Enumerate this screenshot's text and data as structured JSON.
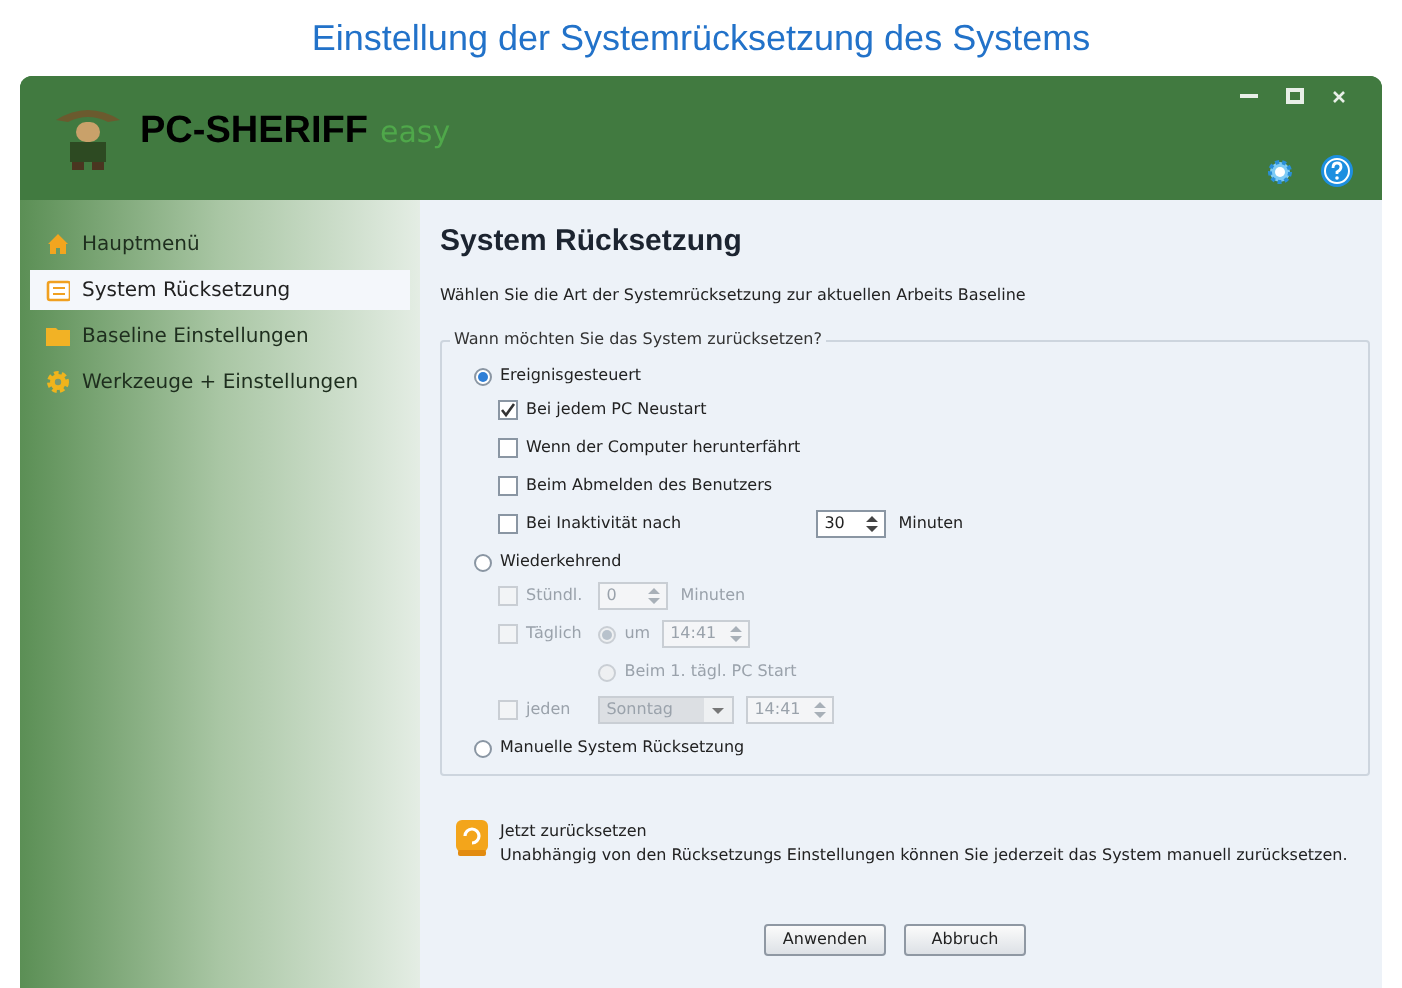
{
  "caption": "Einstellung der Systemrücksetzung des Systems",
  "app": {
    "logo": "PC-SHERIFF",
    "logo_suffix": "easy"
  },
  "sidebar": {
    "items": [
      {
        "label": "Hauptmenü",
        "selected": false
      },
      {
        "label": "System Rücksetzung",
        "selected": true
      },
      {
        "label": "Baseline Einstellungen",
        "selected": false
      },
      {
        "label": "Werkzeuge + Einstellungen",
        "selected": false
      }
    ]
  },
  "content": {
    "title": "System Rücksetzung",
    "subtitle": "Wählen Sie die Art der Systemrücksetzung zur aktuellen Arbeits Baseline",
    "group": {
      "legend": "Wann möchten Sie das System zurücksetzen?",
      "options": [
        {
          "kind": "radio",
          "label": "Ereignisgesteuert",
          "selected": true,
          "disabled": false,
          "children": [
            {
              "kind": "checkbox",
              "label": "Bei jedem PC Neustart",
              "checked": true,
              "disabled": false
            },
            {
              "kind": "checkbox",
              "label": "Wenn der Computer herunterfährt",
              "checked": false,
              "disabled": false
            },
            {
              "kind": "checkbox",
              "label": "Beim Abmelden des Benutzers",
              "checked": false,
              "disabled": false
            },
            {
              "kind": "checkbox",
              "label": "Bei Inaktivität nach",
              "checked": false,
              "disabled": false,
              "controls": [
                {
                  "kind": "spin",
                  "value": "30",
                  "disabled": false
                },
                {
                  "kind": "unit",
                  "label": "Minuten",
                  "disabled": false
                }
              ]
            }
          ]
        },
        {
          "kind": "radio",
          "label": "Wiederkehrend",
          "selected": false,
          "disabled": false,
          "children": [
            {
              "kind": "checkbox",
              "label": "Stündl.",
              "checked": false,
              "disabled": true,
              "controls": [
                {
                  "kind": "spin",
                  "value": "0",
                  "disabled": true
                },
                {
                  "kind": "unit",
                  "label": "Minuten",
                  "disabled": true
                }
              ]
            },
            {
              "kind": "checkbox",
              "label": "Täglich",
              "checked": false,
              "disabled": true,
              "controls": [
                {
                  "kind": "radio",
                  "label": "um",
                  "selected": true,
                  "disabled": true
                },
                {
                  "kind": "spin",
                  "value": "14:41",
                  "disabled": true
                }
              ],
              "children": [
                {
                  "kind": "radio",
                  "label": "Beim 1. tägl. PC Start",
                  "selected": false,
                  "disabled": true
                }
              ]
            },
            {
              "kind": "checkbox",
              "label": "jeden",
              "checked": false,
              "disabled": true,
              "controls": [
                {
                  "kind": "dropdown",
                  "value": "Sonntag",
                  "disabled": true
                },
                {
                  "kind": "spin",
                  "value": "14:41",
                  "disabled": true
                }
              ]
            }
          ]
        },
        {
          "kind": "radio",
          "label": "Manuelle System Rücksetzung",
          "selected": false,
          "disabled": false
        }
      ]
    },
    "reset": {
      "title": "Jetzt zurücksetzen",
      "text": "Unabhängig von den Rücksetzungs Einstellungen können Sie jederzeit das System manuell zurücksetzen."
    },
    "buttons": [
      "Anwenden",
      "Abbruch"
    ]
  }
}
